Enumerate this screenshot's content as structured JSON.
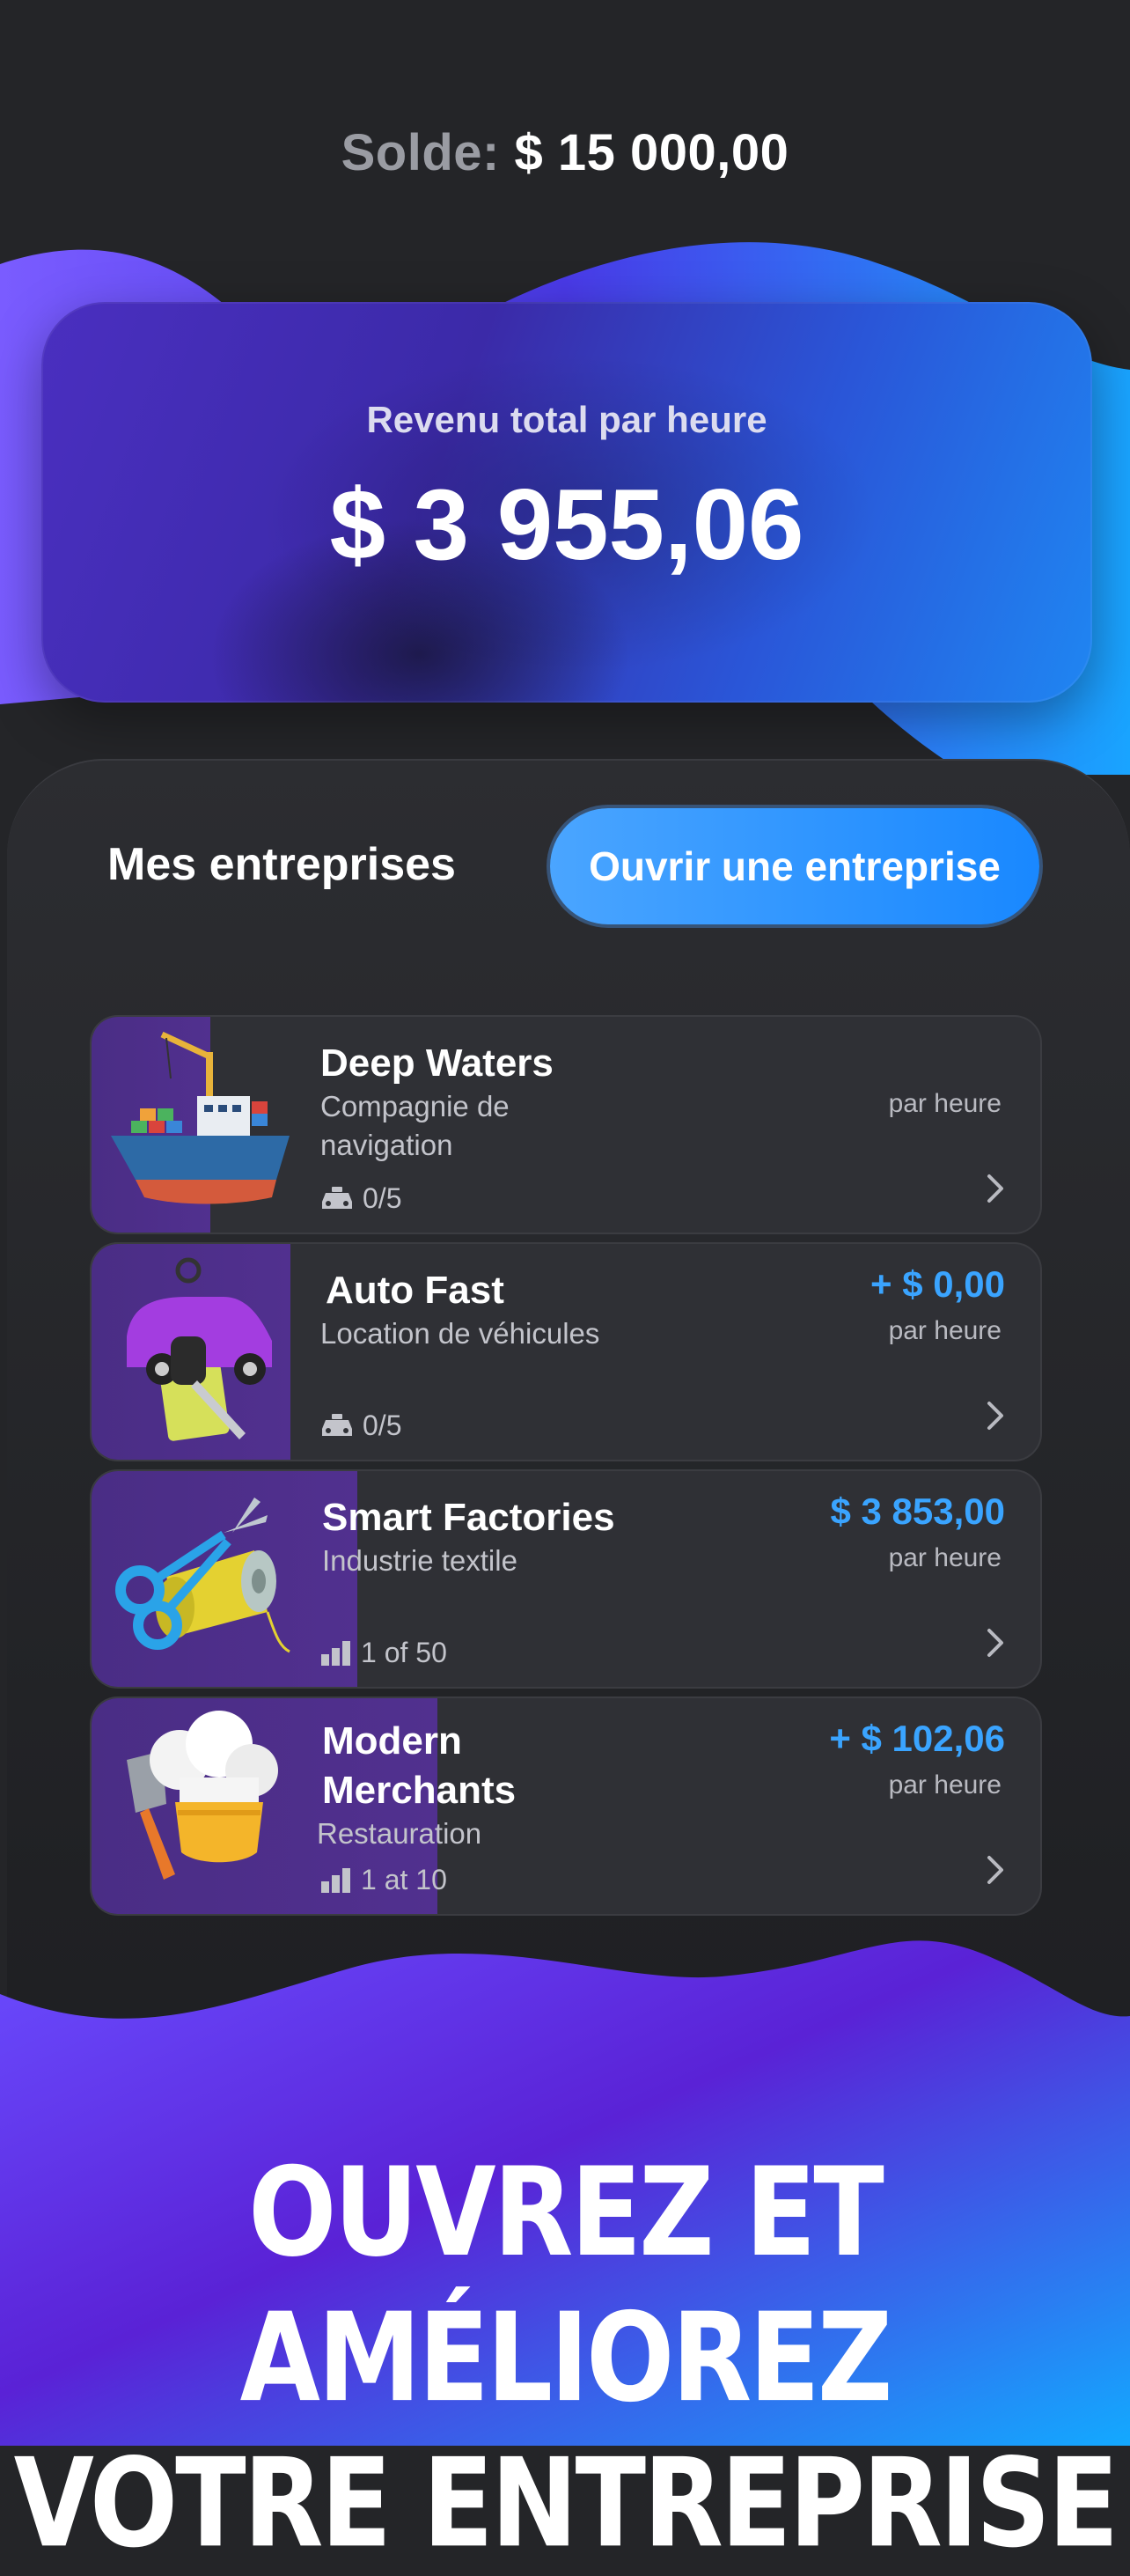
{
  "header": {
    "balance_label": "Solde:",
    "balance_value": "$ 15 000,00"
  },
  "revenue": {
    "label": "Revenu total par heure",
    "value": "$ 3 955,06"
  },
  "companies_section": {
    "title": "Mes entreprises",
    "open_button": "Ouvrir une entreprise"
  },
  "companies": [
    {
      "name": "Deep Waters",
      "subtitle_line1": "Compagnie de",
      "subtitle_line2": "navigation",
      "level": "0/5",
      "level_icon": "taxi-icon",
      "income": "",
      "per": "par heure",
      "progress": 0.125
    },
    {
      "name": "Auto Fast",
      "subtitle_line1": "Location de véhicules",
      "level": "0/5",
      "level_icon": "taxi-icon",
      "income": "+ $ 0,00",
      "per": "par heure",
      "progress": 0.21
    },
    {
      "name": "Smart Factories",
      "subtitle_line1": "Industrie textile",
      "level": "1 of 50",
      "level_icon": "bar-chart-icon",
      "income": "$ 3 853,00",
      "per": "par heure",
      "progress": 0.28
    },
    {
      "name_line1": "Modern",
      "name_line2": "Merchants",
      "subtitle_line1": "Restauration",
      "level": "1 at 10",
      "level_icon": "bar-chart-icon",
      "income": "+ $ 102,06",
      "per": "par heure",
      "progress": 0.365
    }
  ],
  "colors": {
    "background": "#242528",
    "accent_blue": "#3aa4ff",
    "progress_purple": "#4a2d85",
    "button_blue": "#1988ff"
  },
  "tagline": {
    "line1": "OUVREZ ET AMÉLIOREZ",
    "line2": "VOTRE ENTREPRISE"
  }
}
